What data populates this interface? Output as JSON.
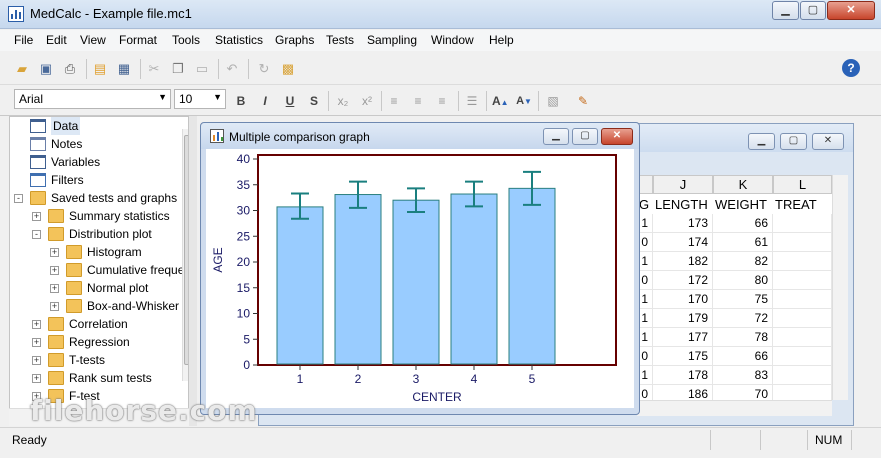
{
  "window": {
    "title": "MedCalc - Example file.mc1"
  },
  "menu": [
    "File",
    "Edit",
    "View",
    "Format",
    "Tools",
    "Statistics",
    "Graphs",
    "Tests",
    "Sampling",
    "Window",
    "Help"
  ],
  "toolbar": {
    "help_label": "?",
    "font_name": "Arial",
    "font_size": "10",
    "bold": "B",
    "italic": "I",
    "underline": "U",
    "shadow": "S",
    "subscript": "x₂",
    "superscript": "x²",
    "grow_font": "A",
    "shrink_font": "A"
  },
  "tree": {
    "items": [
      {
        "label": "Data",
        "level": 0,
        "icon": "grid"
      },
      {
        "label": "Notes",
        "level": 0,
        "icon": "notes"
      },
      {
        "label": "Variables",
        "level": 0,
        "icon": "variables"
      },
      {
        "label": "Filters",
        "level": 0,
        "icon": "filter"
      },
      {
        "label": "Saved tests and graphs",
        "level": 0,
        "icon": "folder",
        "expander": "-"
      },
      {
        "label": "Summary statistics",
        "level": 1,
        "icon": "folder",
        "expander": "+"
      },
      {
        "label": "Distribution plot",
        "level": 1,
        "icon": "folder",
        "expander": "-"
      },
      {
        "label": "Histogram",
        "level": 2,
        "icon": "folder",
        "expander": "+"
      },
      {
        "label": "Cumulative freque",
        "level": 2,
        "icon": "folder",
        "expander": "+"
      },
      {
        "label": "Normal plot",
        "level": 2,
        "icon": "folder",
        "expander": "+"
      },
      {
        "label": "Box-and-Whisker",
        "level": 2,
        "icon": "folder",
        "expander": "+"
      },
      {
        "label": "Correlation",
        "level": 1,
        "icon": "folder",
        "expander": "+"
      },
      {
        "label": "Regression",
        "level": 1,
        "icon": "folder",
        "expander": "+"
      },
      {
        "label": "T-tests",
        "level": 1,
        "icon": "folder",
        "expander": "+"
      },
      {
        "label": "Rank sum tests",
        "level": 1,
        "icon": "folder",
        "expander": "+"
      },
      {
        "label": "F-test",
        "level": 1,
        "icon": "folder",
        "expander": "+"
      }
    ]
  },
  "spreadsheet": {
    "columns": [
      {
        "letter": "",
        "header": "G"
      },
      {
        "letter": "J",
        "header": "LENGTH"
      },
      {
        "letter": "K",
        "header": "WEIGHT"
      },
      {
        "letter": "L",
        "header": "TREAT"
      }
    ],
    "rows": [
      [
        "1",
        "173",
        "66",
        ""
      ],
      [
        "0",
        "174",
        "61",
        ""
      ],
      [
        "1",
        "182",
        "82",
        ""
      ],
      [
        "0",
        "172",
        "80",
        ""
      ],
      [
        "1",
        "170",
        "75",
        ""
      ],
      [
        "1",
        "179",
        "72",
        ""
      ],
      [
        "1",
        "177",
        "78",
        ""
      ],
      [
        "0",
        "175",
        "66",
        ""
      ],
      [
        "1",
        "178",
        "83",
        ""
      ],
      [
        "0",
        "186",
        "70",
        ""
      ]
    ]
  },
  "graph_window": {
    "title": "Multiple comparison graph"
  },
  "chart_data": {
    "type": "bar",
    "categories": [
      "1",
      "2",
      "3",
      "4",
      "5"
    ],
    "values": [
      30.7,
      33.1,
      32.0,
      33.2,
      34.3
    ],
    "error_low": [
      28.4,
      30.5,
      29.7,
      30.8,
      31.1
    ],
    "error_high": [
      33.3,
      35.6,
      34.3,
      35.6,
      37.5
    ],
    "xlabel": "CENTER",
    "ylabel": "AGE",
    "ylim": [
      0,
      40
    ],
    "yticks": [
      "0",
      "5",
      "10",
      "15",
      "20",
      "25",
      "30",
      "35",
      "40"
    ],
    "bar_color": "#99ccff",
    "bar_edge_color": "#2a7f7f",
    "error_color": "#1a7f7f",
    "frame_color": "#660000"
  },
  "status": {
    "text": "Ready",
    "num": "NUM"
  },
  "watermark": "filehorse.com"
}
